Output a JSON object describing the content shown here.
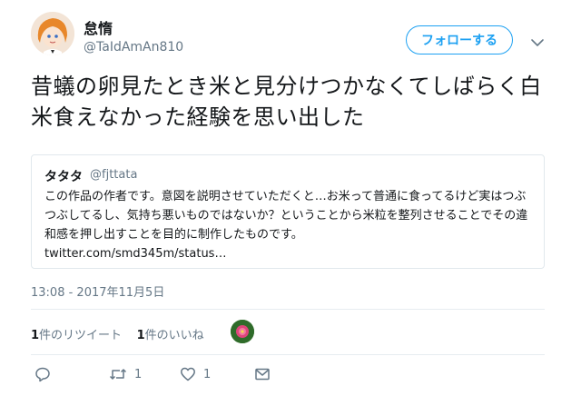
{
  "user": {
    "display_name": "怠惰",
    "handle": "@TaIdAmAn810",
    "follow_label": "フォローする"
  },
  "tweet": {
    "text": "昔蟻の卵見たとき米と見分けつかなくてしばらく白米食えなかった経験を思い出した"
  },
  "quoted": {
    "name": "タタタ",
    "handle": "@fjttata",
    "text": "この作品の作者です。意図を説明させていただくと…お米って普通に食ってるけど実はつぶつぶしてるし、気持ち悪いものではないか？ということから米粒を整列させることでその違和感を押し出すことを目的に制作したものです。",
    "link": "twitter.com/smd345m/status…"
  },
  "timestamp": "13:08 - 2017年11月5日",
  "stats": {
    "retweet_count": "1",
    "retweet_label": "件のリツイート",
    "like_count": "1",
    "like_label": "件のいいね"
  },
  "actions": {
    "reply_icon": "reply-icon",
    "retweet_icon": "retweet-icon",
    "retweet_count": "1",
    "like_icon": "heart-icon",
    "like_count": "1",
    "dm_icon": "envelope-icon"
  },
  "colors": {
    "accent": "#1da1f2",
    "text": "#14171a",
    "secondary": "#657786",
    "border": "#e1e8ed"
  }
}
